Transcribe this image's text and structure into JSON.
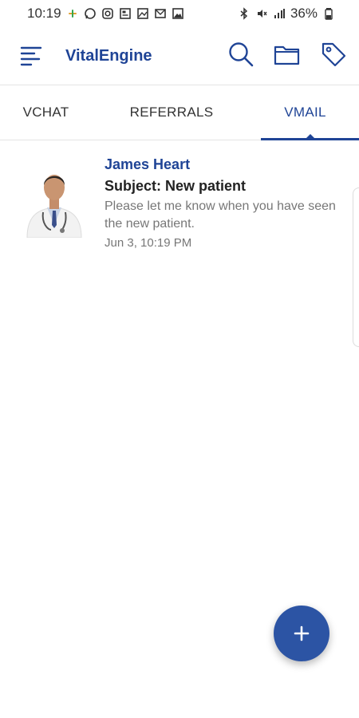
{
  "status_bar": {
    "time": "10:19",
    "battery_percent": "36%",
    "left_icons": [
      "slack-icon",
      "whatsapp-icon",
      "instagram-icon",
      "news-icon",
      "gallery-icon",
      "mail-icon",
      "image-icon"
    ],
    "right_icons": [
      "bluetooth-icon",
      "mute-icon",
      "signal-icon",
      "battery-icon"
    ]
  },
  "app_bar": {
    "title": "VitalEngine",
    "menu_icon": "menu-icon",
    "actions": [
      "search-icon",
      "folder-icon",
      "tag-icon"
    ]
  },
  "tabs": [
    {
      "label": "VCHAT",
      "active": false
    },
    {
      "label": "REFERRALS",
      "active": false
    },
    {
      "label": "VMAIL",
      "active": true
    }
  ],
  "messages": [
    {
      "sender": "James Heart",
      "subject": "Subject: New patient",
      "preview": "Please let me know when you have seen the new patient.",
      "date": "Jun 3, 10:19 PM"
    }
  ],
  "fab": {
    "icon": "plus-icon"
  },
  "colors": {
    "brand": "#1f4496",
    "fab": "#2c54a4",
    "muted_text": "#777777"
  }
}
